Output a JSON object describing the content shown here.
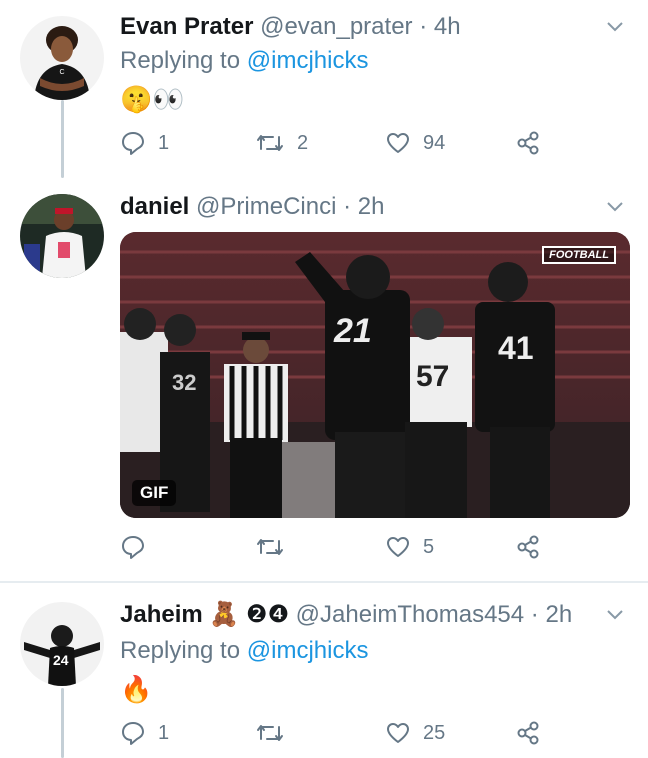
{
  "tweets": [
    {
      "name": "Evan Prater",
      "handle": "@evan_prater",
      "time": "4h",
      "replying_prefix": "Replying to ",
      "replying_to": "@imcjhicks",
      "content": "🤫👀",
      "reply_count": "1",
      "retweet_count": "2",
      "like_count": "94"
    },
    {
      "name": "daniel",
      "handle": "@PrimeCinci",
      "time": "2h",
      "gif_label": "GIF",
      "media_badge": "FOOTBALL",
      "jerseys": [
        "21",
        "41",
        "57",
        "32"
      ],
      "reply_count": "",
      "retweet_count": "",
      "like_count": "5"
    },
    {
      "name": "Jaheim",
      "name_emoji": "🧸",
      "name_badge": "❷❹",
      "handle": "@JaheimThomas454",
      "time": "2h",
      "avatar_jersey": "24",
      "replying_prefix": "Replying to ",
      "replying_to": "@imcjhicks",
      "content": "🔥",
      "reply_count": "1",
      "retweet_count": "",
      "like_count": "25"
    }
  ],
  "separator": "·",
  "colors": {
    "text": "#14171a",
    "secondary": "#657786",
    "link": "#1b95e0",
    "divider": "#e6ecf0",
    "thread_line": "#c4cfd6"
  }
}
